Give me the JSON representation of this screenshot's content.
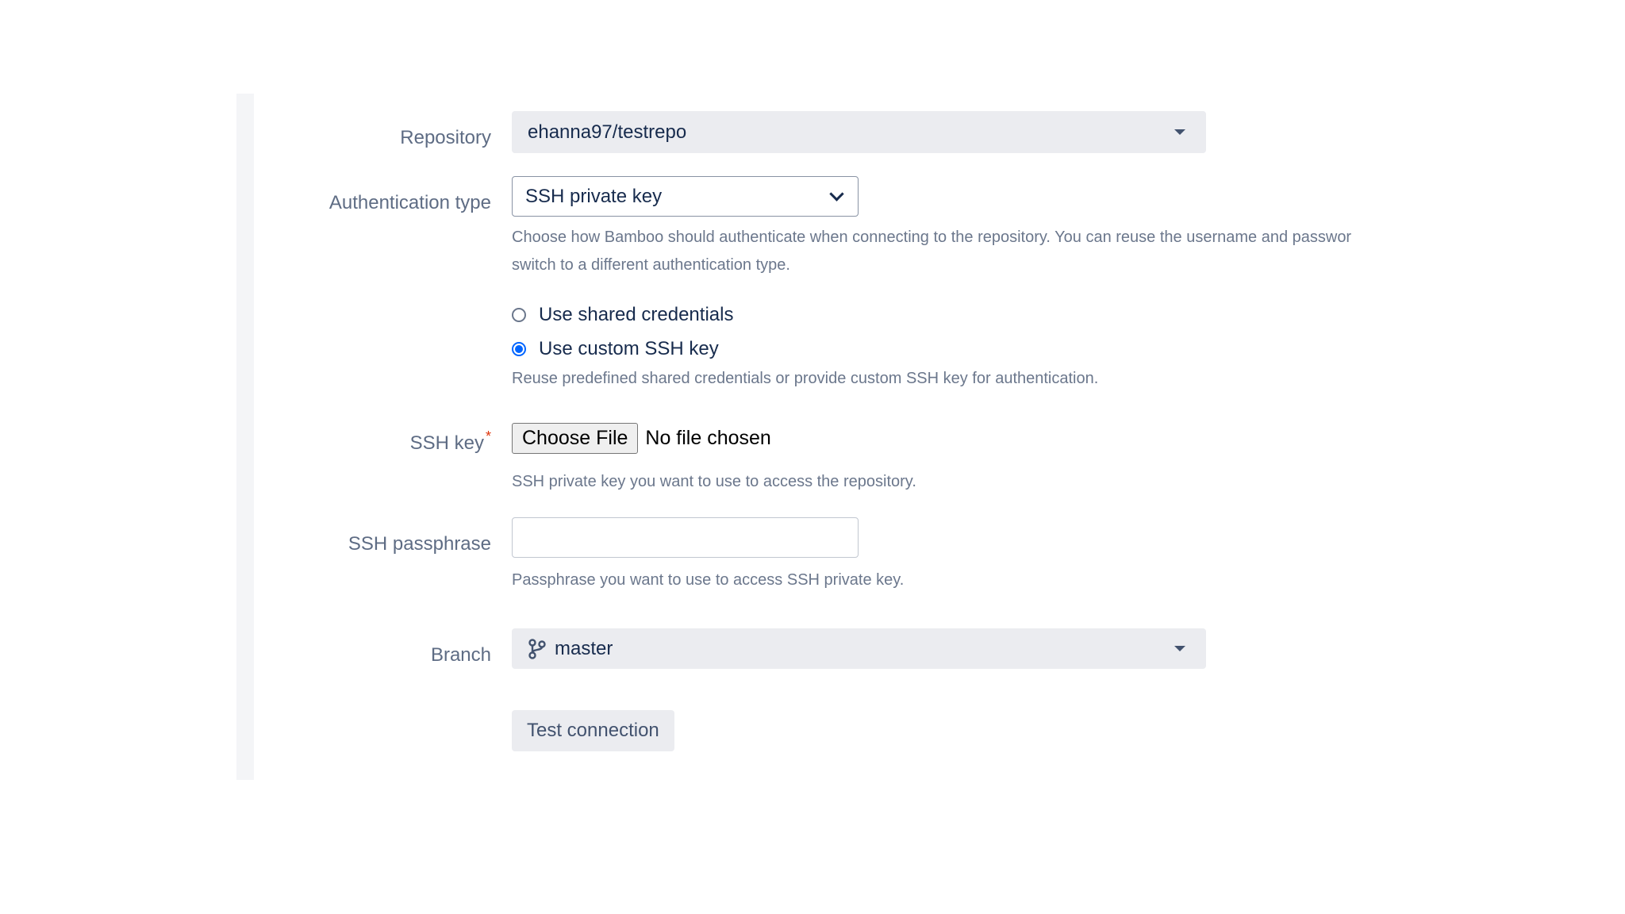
{
  "form": {
    "repository": {
      "label": "Repository",
      "value": "ehanna97/testrepo"
    },
    "auth_type": {
      "label": "Authentication type",
      "value": "SSH private key",
      "help_line1": "Choose how Bamboo should authenticate when connecting to the repository. You can reuse the username and passwor",
      "help_line2": "switch to a different authentication type."
    },
    "credentials": {
      "options": [
        {
          "label": "Use shared credentials",
          "selected": false
        },
        {
          "label": "Use custom SSH key",
          "selected": true
        }
      ],
      "help": "Reuse predefined shared credentials or provide custom SSH key for authentication."
    },
    "ssh_key": {
      "label": "SSH key",
      "required_mark": "*",
      "button_label": "Choose File",
      "file_status": "No file chosen",
      "help": "SSH private key you want to use to access the repository."
    },
    "ssh_passphrase": {
      "label": "SSH passphrase",
      "value": "",
      "help": "Passphrase you want to use to access SSH private key."
    },
    "branch": {
      "label": "Branch",
      "value": "master",
      "icon": "branch-icon"
    },
    "test_button_label": "Test connection"
  },
  "colors": {
    "accent": "#0065ff",
    "required": "#de350b",
    "label": "#5e6c84",
    "help": "#6b778c",
    "field_bg": "#ebecf0"
  }
}
